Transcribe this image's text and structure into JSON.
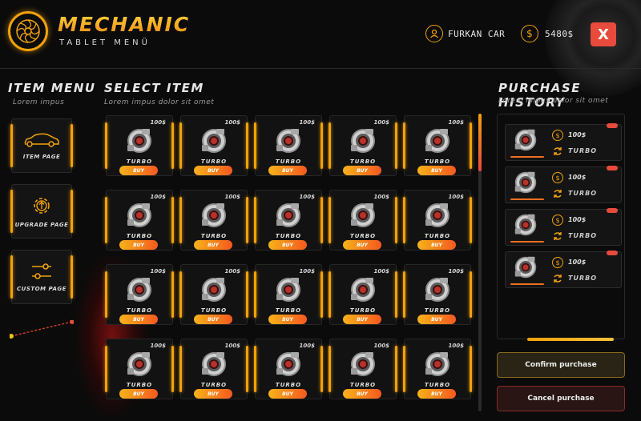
{
  "header": {
    "brand_title": "MECHANIC",
    "brand_subtitle": "TABLET MENÜ",
    "user_name": "FURKAN CAR",
    "money": "5480$",
    "close_label": "X"
  },
  "left_menu": {
    "title": "ITEM MENU",
    "subtitle": "Lorem impus",
    "items": [
      {
        "label": "ITEM PAGE",
        "icon": "car-icon"
      },
      {
        "label": "UPGRADE PAGE",
        "icon": "gear-upgrade-icon"
      },
      {
        "label": "CUSTOM PAGE",
        "icon": "sliders-icon"
      }
    ]
  },
  "select_item": {
    "title": "SELECT ITEM",
    "subtitle": "Lorem impus dolor sit omet",
    "items": [
      {
        "price": "100$",
        "name": "TURBO",
        "buy": "BUY"
      },
      {
        "price": "100$",
        "name": "TURBO",
        "buy": "BUY"
      },
      {
        "price": "100$",
        "name": "TURBO",
        "buy": "BUY"
      },
      {
        "price": "100$",
        "name": "TURBO",
        "buy": "BUY"
      },
      {
        "price": "100$",
        "name": "TURBO",
        "buy": "BUY"
      },
      {
        "price": "100$",
        "name": "TURBO",
        "buy": "BUY"
      },
      {
        "price": "100$",
        "name": "TURBO",
        "buy": "BUY"
      },
      {
        "price": "100$",
        "name": "TURBO",
        "buy": "BUY"
      },
      {
        "price": "100$",
        "name": "TURBO",
        "buy": "BUY"
      },
      {
        "price": "100$",
        "name": "TURBO",
        "buy": "BUY"
      },
      {
        "price": "100$",
        "name": "TURBO",
        "buy": "BUY"
      },
      {
        "price": "100$",
        "name": "TURBO",
        "buy": "BUY"
      },
      {
        "price": "100$",
        "name": "TURBO",
        "buy": "BUY"
      },
      {
        "price": "100$",
        "name": "TURBO",
        "buy": "BUY"
      },
      {
        "price": "100$",
        "name": "TURBO",
        "buy": "BUY"
      },
      {
        "price": "100$",
        "name": "TURBO",
        "buy": "BUY"
      },
      {
        "price": "100$",
        "name": "TURBO",
        "buy": "BUY"
      },
      {
        "price": "100$",
        "name": "TURBO",
        "buy": "BUY"
      },
      {
        "price": "100$",
        "name": "TURBO",
        "buy": "BUY"
      },
      {
        "price": "100$",
        "name": "TURBO",
        "buy": "BUY"
      }
    ]
  },
  "history": {
    "title": "PURCHASE HISTORY",
    "subtitle": "Lorem impus dolor sit omet",
    "items": [
      {
        "price": "100$",
        "name": "TURBO"
      },
      {
        "price": "100$",
        "name": "TURBO"
      },
      {
        "price": "100$",
        "name": "TURBO"
      },
      {
        "price": "100$",
        "name": "TURBO"
      }
    ],
    "confirm_label": "Confirm purchase",
    "cancel_label": "Cancel purchase"
  },
  "colors": {
    "accent": "#f2a10a",
    "danger": "#e84b3c",
    "background": "#0b0b0b"
  }
}
